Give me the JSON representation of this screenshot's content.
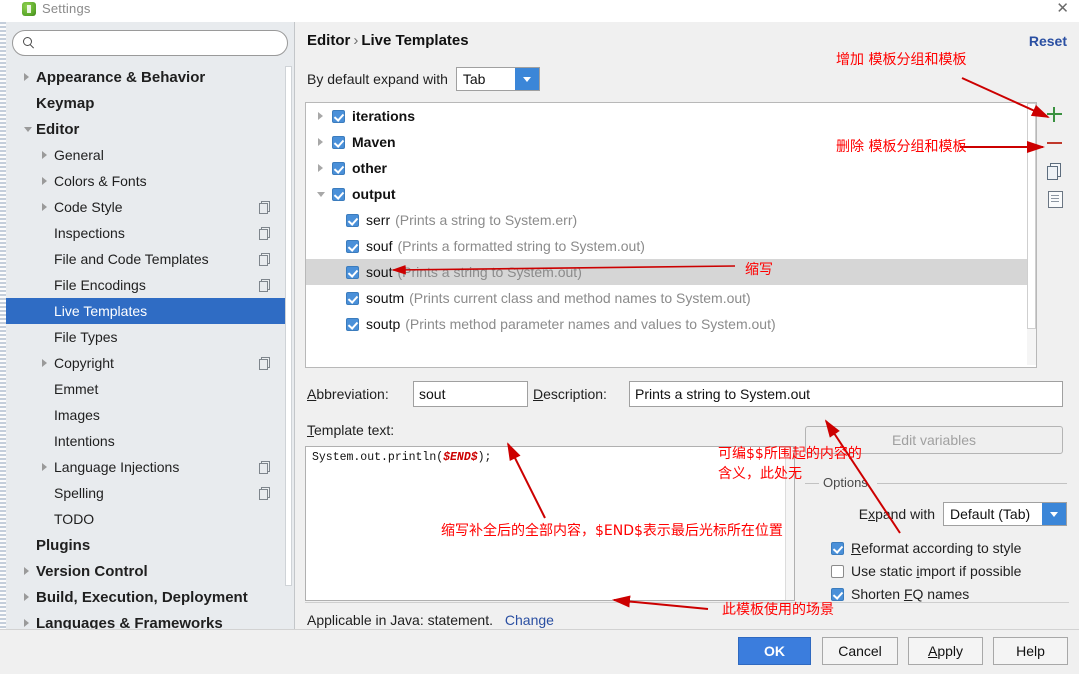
{
  "window": {
    "title": "Settings",
    "close_label": "✕",
    "app_icon": "intellij-icon"
  },
  "sidebar": {
    "search": {
      "value": "",
      "placeholder": ""
    },
    "items": [
      {
        "label": "Appearance & Behavior",
        "level": 0,
        "twisty": "collapsed",
        "badge": false,
        "selected": false
      },
      {
        "label": "Keymap",
        "level": 0,
        "twisty": "none",
        "badge": false,
        "selected": false
      },
      {
        "label": "Editor",
        "level": 0,
        "twisty": "expanded",
        "badge": false,
        "selected": false
      },
      {
        "label": "General",
        "level": 1,
        "twisty": "collapsed",
        "badge": false,
        "selected": false
      },
      {
        "label": "Colors & Fonts",
        "level": 1,
        "twisty": "collapsed",
        "badge": false,
        "selected": false
      },
      {
        "label": "Code Style",
        "level": 1,
        "twisty": "collapsed",
        "badge": true,
        "selected": false
      },
      {
        "label": "Inspections",
        "level": 1,
        "twisty": "none",
        "badge": true,
        "selected": false
      },
      {
        "label": "File and Code Templates",
        "level": 1,
        "twisty": "none",
        "badge": true,
        "selected": false
      },
      {
        "label": "File Encodings",
        "level": 1,
        "twisty": "none",
        "badge": true,
        "selected": false
      },
      {
        "label": "Live Templates",
        "level": 1,
        "twisty": "none",
        "badge": false,
        "selected": true
      },
      {
        "label": "File Types",
        "level": 1,
        "twisty": "none",
        "badge": false,
        "selected": false
      },
      {
        "label": "Copyright",
        "level": 1,
        "twisty": "collapsed",
        "badge": true,
        "selected": false
      },
      {
        "label": "Emmet",
        "level": 1,
        "twisty": "none",
        "badge": false,
        "selected": false
      },
      {
        "label": "Images",
        "level": 1,
        "twisty": "none",
        "badge": false,
        "selected": false
      },
      {
        "label": "Intentions",
        "level": 1,
        "twisty": "none",
        "badge": false,
        "selected": false
      },
      {
        "label": "Language Injections",
        "level": 1,
        "twisty": "collapsed",
        "badge": true,
        "selected": false
      },
      {
        "label": "Spelling",
        "level": 1,
        "twisty": "none",
        "badge": true,
        "selected": false
      },
      {
        "label": "TODO",
        "level": 1,
        "twisty": "none",
        "badge": false,
        "selected": false
      },
      {
        "label": "Plugins",
        "level": 0,
        "twisty": "none",
        "badge": false,
        "selected": false
      },
      {
        "label": "Version Control",
        "level": 0,
        "twisty": "collapsed",
        "badge": false,
        "selected": false
      },
      {
        "label": "Build, Execution, Deployment",
        "level": 0,
        "twisty": "collapsed",
        "badge": false,
        "selected": false
      },
      {
        "label": "Languages & Frameworks",
        "level": 0,
        "twisty": "collapsed",
        "badge": false,
        "selected": false
      }
    ]
  },
  "main": {
    "breadcrumb_root": "Editor",
    "breadcrumb_sep": "›",
    "breadcrumb_leaf": "Live Templates",
    "reset_label": "Reset",
    "expand_with_label": "By default expand with",
    "expand_with_value": "Tab"
  },
  "templates_tree": {
    "rows": [
      {
        "kind": "group",
        "checked": true,
        "twisty": "collapsed",
        "name": "iterations",
        "desc": "",
        "selected": false
      },
      {
        "kind": "group",
        "checked": true,
        "twisty": "collapsed",
        "name": "Maven",
        "desc": "",
        "selected": false
      },
      {
        "kind": "group",
        "checked": true,
        "twisty": "collapsed",
        "name": "other",
        "desc": "",
        "selected": false
      },
      {
        "kind": "group",
        "checked": true,
        "twisty": "expanded",
        "name": "output",
        "desc": "",
        "selected": false
      },
      {
        "kind": "item",
        "checked": true,
        "twisty": "none",
        "name": "serr",
        "desc": "(Prints a string to System.err)",
        "selected": false
      },
      {
        "kind": "item",
        "checked": true,
        "twisty": "none",
        "name": "souf",
        "desc": "(Prints a formatted string to System.out)",
        "selected": false
      },
      {
        "kind": "item",
        "checked": true,
        "twisty": "none",
        "name": "sout",
        "desc": "(Prints a string to System.out)",
        "selected": true
      },
      {
        "kind": "item",
        "checked": true,
        "twisty": "none",
        "name": "soutm",
        "desc": "(Prints current class and method names to System.out)",
        "selected": false
      },
      {
        "kind": "item",
        "checked": true,
        "twisty": "none",
        "name": "soutp",
        "desc": "(Prints method parameter names and values to System.out)",
        "selected": false
      }
    ]
  },
  "toolbar": {
    "add_icon": "plus-icon",
    "remove_icon": "minus-icon",
    "duplicate_icon": "copy-icon",
    "list_icon": "document-icon"
  },
  "editor_fields": {
    "abbreviation_label": "Abbreviation:",
    "abbreviation_value": "sout",
    "description_label": "Description:",
    "description_value": "Prints a string to System.out",
    "template_text_label": "Template text:",
    "template_code_prefix": "System.out.println(",
    "template_code_var": "$END$",
    "template_code_suffix": ");"
  },
  "options": {
    "edit_variables_label": "Edit variables",
    "legend": "Options",
    "expand_with_label": "Expand with",
    "expand_with_value": "Default (Tab)",
    "checkboxes": [
      {
        "label": "Reformat according to style",
        "checked": true
      },
      {
        "label": "Use static import if possible",
        "checked": false
      },
      {
        "label": "Shorten FQ names",
        "checked": true
      }
    ]
  },
  "footer": {
    "applicable_text": "Applicable in Java: statement.",
    "change_label": "Change"
  },
  "buttons": {
    "ok": "OK",
    "cancel": "Cancel",
    "apply": "Apply",
    "help": "Help"
  },
  "annotations": [
    {
      "id": "add-group",
      "text": "增加 模板分组和模板"
    },
    {
      "id": "remove-group",
      "text": "删除 模板分组和模板"
    },
    {
      "id": "abbreviation",
      "text": "缩写"
    },
    {
      "id": "edit-variables",
      "text": "可编$$所围起的内容的\n含义，此处无"
    },
    {
      "id": "template-text",
      "text": "缩写补全后的全部内容，$END$表示最后光标所在位置"
    },
    {
      "id": "applicable-context",
      "text": "此模板使用的场景"
    }
  ],
  "colors": {
    "selection_blue": "#2f6cc4",
    "checkbox_blue": "#4a90d9",
    "annotation_red": "#ff0000",
    "link_blue": "#2a4fa2",
    "primary_button": "#3b7ddd"
  }
}
